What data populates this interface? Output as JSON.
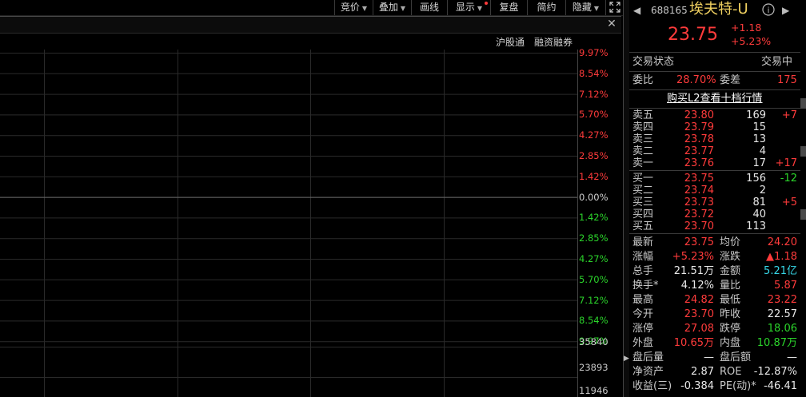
{
  "toolbar": {
    "bidding": "竞价",
    "overlay": "叠加",
    "draw": "画线",
    "display": "显示",
    "review": "复盘",
    "simple": "简约",
    "hide": "隐藏"
  },
  "links": {
    "hk_connect": "沪股通",
    "margin": "融资融券"
  },
  "chart_data": {
    "type": "line",
    "pct_ticks": [
      "9.97%",
      "8.54%",
      "7.12%",
      "5.70%",
      "4.27%",
      "2.85%",
      "1.42%",
      "0.00%",
      "1.42%",
      "2.85%",
      "4.27%",
      "5.70%",
      "7.12%",
      "8.54%",
      "9.97%"
    ],
    "volume_ticks": [
      "35840",
      "23893",
      "11946"
    ],
    "series": []
  },
  "stock": {
    "code": "688165",
    "name": "埃夫特-U",
    "price": "23.75",
    "change": "+1.18",
    "change_pct": "+5.23%"
  },
  "status": {
    "label": "交易状态",
    "value": "交易中",
    "ratio_label": "委比",
    "ratio_value": "28.70%",
    "diff_label": "委差",
    "diff_value": "175"
  },
  "l2_link": "购买L2查看十档行情",
  "asks": [
    {
      "label": "卖五",
      "price": "23.80",
      "vol": "169",
      "chg": "+7"
    },
    {
      "label": "卖四",
      "price": "23.79",
      "vol": "15",
      "chg": ""
    },
    {
      "label": "卖三",
      "price": "23.78",
      "vol": "13",
      "chg": ""
    },
    {
      "label": "卖二",
      "price": "23.77",
      "vol": "4",
      "chg": ""
    },
    {
      "label": "卖一",
      "price": "23.76",
      "vol": "17",
      "chg": "+17"
    }
  ],
  "bids": [
    {
      "label": "买一",
      "price": "23.75",
      "vol": "156",
      "chg": "-12"
    },
    {
      "label": "买二",
      "price": "23.74",
      "vol": "2",
      "chg": ""
    },
    {
      "label": "买三",
      "price": "23.73",
      "vol": "81",
      "chg": "+5"
    },
    {
      "label": "买四",
      "price": "23.72",
      "vol": "40",
      "chg": ""
    },
    {
      "label": "买五",
      "price": "23.70",
      "vol": "113",
      "chg": ""
    }
  ],
  "stats": [
    {
      "l1": "最新",
      "v1": "23.75",
      "c1": "red",
      "l2": "均价",
      "v2": "24.20",
      "c2": "red"
    },
    {
      "l1": "涨幅",
      "v1": "+5.23%",
      "c1": "red",
      "l2": "涨跌",
      "v2": "▲1.18",
      "c2": "red"
    },
    {
      "l1": "总手",
      "v1": "21.51万",
      "c1": "white",
      "l2": "金额",
      "v2": "5.21亿",
      "c2": "cyan"
    },
    {
      "l1": "换手*",
      "v1": "4.12%",
      "c1": "white",
      "l2": "量比",
      "v2": "5.87",
      "c2": "red"
    },
    {
      "l1": "最高",
      "v1": "24.82",
      "c1": "red",
      "l2": "最低",
      "v2": "23.22",
      "c2": "red"
    },
    {
      "l1": "今开",
      "v1": "23.70",
      "c1": "red",
      "l2": "昨收",
      "v2": "22.57",
      "c2": "white"
    },
    {
      "l1": "涨停",
      "v1": "27.08",
      "c1": "red",
      "l2": "跌停",
      "v2": "18.06",
      "c2": "green"
    },
    {
      "l1": "外盘",
      "v1": "10.65万",
      "c1": "red",
      "l2": "内盘",
      "v2": "10.87万",
      "c2": "green"
    },
    {
      "l1": "盘后量",
      "v1": "—",
      "c1": "white",
      "l2": "盘后额",
      "v2": "—",
      "c2": "white"
    },
    {
      "l1": "净资产",
      "v1": "2.87",
      "c1": "white",
      "l2": "ROE",
      "v2": "-12.87%",
      "c2": "white"
    },
    {
      "l1": "收益(三)",
      "v1": "-0.384",
      "c1": "white",
      "l2": "PE(动)*",
      "v2": "-46.41",
      "c2": "white"
    }
  ],
  "colors": {
    "up": "#ff3b3b",
    "down": "#2bd52b",
    "amount": "#36d6e6"
  }
}
